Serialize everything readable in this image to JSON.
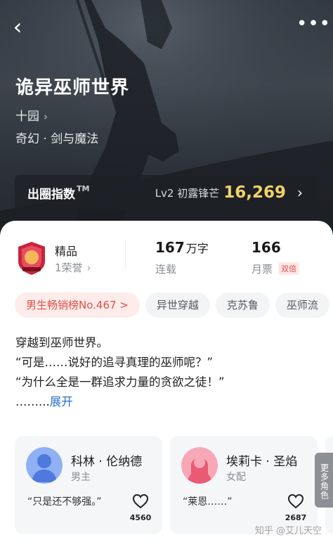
{
  "header": {
    "back_icon": "chevron-left-icon",
    "more_icon": "more-dots-icon",
    "back_glyph": "‹",
    "more_glyph": "•••"
  },
  "book": {
    "title": "诡异巫师世界",
    "author": "十园",
    "author_chevron": "›",
    "genre": "奇幻 · 剑与魔法"
  },
  "index": {
    "label": "出圈指数",
    "tm": "TM",
    "level": "Lv2 初露锋芒",
    "value": "16,269",
    "chevron": "›"
  },
  "stats": {
    "quality_badge_icon": "jingpin-badge-icon",
    "quality": "精品",
    "honors": "1荣誉",
    "honors_chevron": "›",
    "words_num": "167",
    "words_unit": "万字",
    "words_label": "连载",
    "tickets": "166",
    "tickets_label": "月票",
    "double_badge": "双倍"
  },
  "tags": [
    {
      "label": "男生畅销榜No.467 >",
      "kind": "rank"
    },
    {
      "label": "异世穿越",
      "kind": "normal"
    },
    {
      "label": "克苏鲁",
      "kind": "normal"
    },
    {
      "label": "巫师流",
      "kind": "normal"
    }
  ],
  "synopsis": {
    "lines": [
      "穿越到巫师世界。",
      "“可是……说好的追寻真理的巫师呢？”",
      "“为什么全是一群追求力量的贪欲之徒！”"
    ],
    "ellipsis": "……...",
    "expand": "展开"
  },
  "characters": [
    {
      "name": "科林 · 伦纳德",
      "role": "男主",
      "quote": "“只是还不够强。”",
      "likes": "4560",
      "avatar_color": "#5b86e5"
    },
    {
      "name": "埃莉卡 · 圣焰",
      "role": "女配",
      "quote": "“莱恩……”",
      "likes": "2687",
      "avatar_color": "#f0627a"
    }
  ],
  "more_characters": "更多角色",
  "watermark": "知乎 @艾儿天空",
  "colors": {
    "accent_red": "#e0504a",
    "index_gold": "#f2d16b",
    "link_blue": "#2f6fce"
  }
}
